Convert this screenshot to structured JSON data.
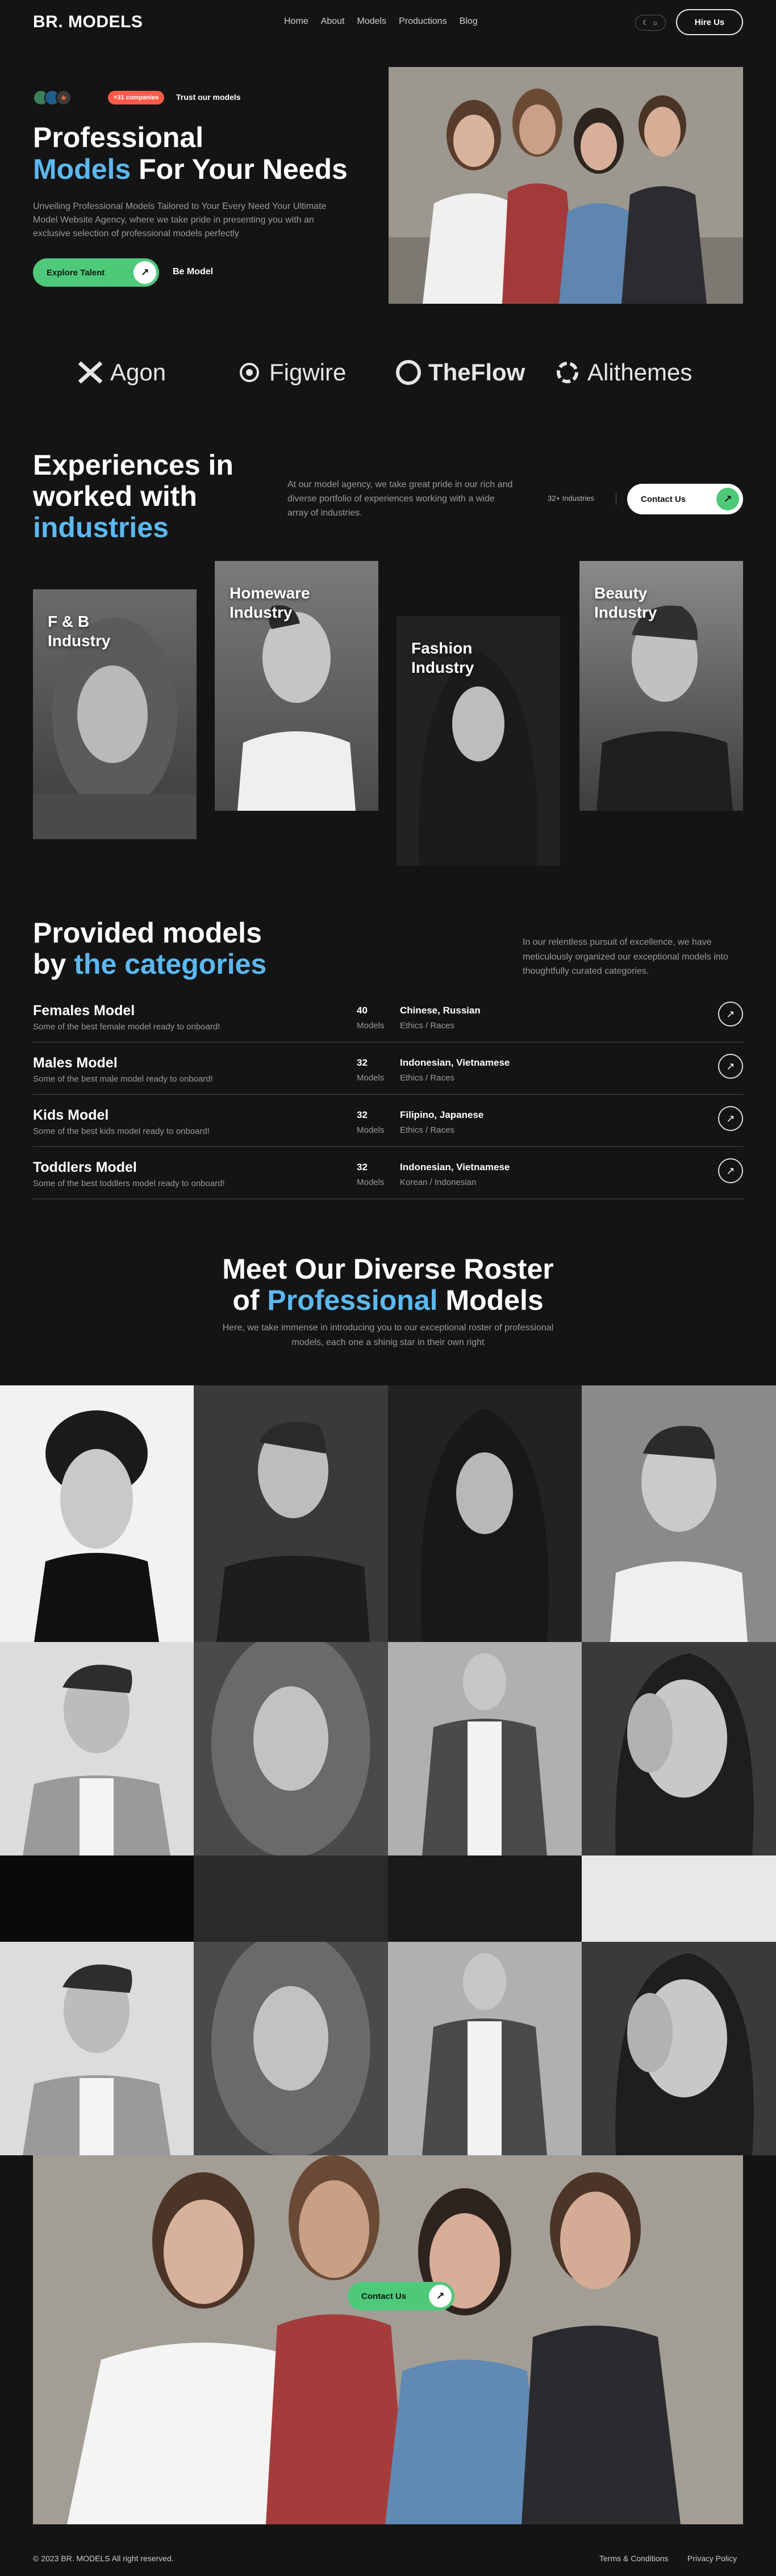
{
  "nav": {
    "logo": "BR. MODELS",
    "links": [
      "Home",
      "About",
      "Models",
      "Productions",
      "Blog"
    ],
    "hire_label": "Hire Us"
  },
  "hero": {
    "badge": "+31 companies",
    "trust": "Trust our models",
    "title_line1": "Professional",
    "title_blue": "Models",
    "title_rest": " For Your Needs",
    "description": "Unveiling Professional Models Tailored to Your Every Need Your Ultimate Model Website Agency, where we take pride in presenting you with an exclusive selection of professional models perfectly",
    "cta_primary": "Explore Talent",
    "cta_secondary": "Be Model"
  },
  "brands": [
    "Agon",
    "Figwire",
    "TheFlow",
    "Alithemes"
  ],
  "experiences": {
    "title_line1": "Experiences in",
    "title_line2": "worked with",
    "title_blue": "industries",
    "description": "At our model agency, we take great pride in our rich and diverse portfolio of experiences working with a wide array of industries.",
    "count": "32+ Industries",
    "contact_label": "Contact Us",
    "cards": [
      {
        "line1": "F & B",
        "line2": "Industry"
      },
      {
        "line1": "Homeware",
        "line2": "Industry"
      },
      {
        "line1": "Fashion",
        "line2": "Industry"
      },
      {
        "line1": "Beauty",
        "line2": "Industry"
      }
    ]
  },
  "categories": {
    "title_line1": "Provided models",
    "title_by": "by ",
    "title_blue": "the categories",
    "description": "In our relentless pursuit of excellence, we have meticulously organized our exceptional models into thoughtfully curated categories.",
    "rows": [
      {
        "name": "Females Model",
        "sub": "Some of the best female model ready to onboard!",
        "count": "40",
        "count_label": "Models",
        "nat": "Chinese, Russian",
        "nat_label": "Ethics / Races"
      },
      {
        "name": "Males Model",
        "sub": "Some of the best male model ready to onboard!",
        "count": "32",
        "count_label": "Models",
        "nat": "Indonesian, Vietnamese",
        "nat_label": "Ethics / Races"
      },
      {
        "name": "Kids Model",
        "sub": "Some of the best kids model ready to onboard!",
        "count": "32",
        "count_label": "Models",
        "nat": "Filipino, Japanese",
        "nat_label": "Ethics / Races"
      },
      {
        "name": "Toddlers Model",
        "sub": "Some of the best toddlers model ready to onboard!",
        "count": "32",
        "count_label": "Models",
        "nat": "Indonesian, Vietnamese",
        "nat_label": "Korean / Indonesian"
      }
    ]
  },
  "roster": {
    "title_line1": "Meet Our Diverse Roster",
    "title_of": "of ",
    "title_blue": "Professional",
    "title_rest": " Models",
    "description": "Here, we take immense in introducing you to our exceptional roster of professional models, each one a shinig star in their own right"
  },
  "bottom_cta": "Contact Us",
  "footer": {
    "copyright": "© 2023 BR. MODELS All right reserved.",
    "terms": "Terms & Conditions",
    "privacy": "Privacy Policy"
  },
  "colors": {
    "background": "#141414",
    "accent_green": "#4ec97a",
    "accent_blue": "#5bb8f0",
    "badge_red": "#ff5a4a"
  }
}
